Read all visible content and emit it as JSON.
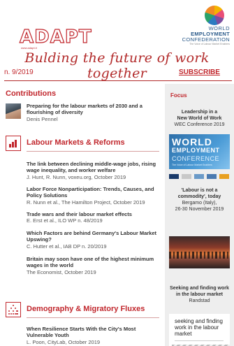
{
  "header": {
    "logo_text": "ADAPT",
    "logo_url": "www.adapt.it",
    "wec": {
      "line1": "WORLD",
      "line2": "EMPLOYMENT",
      "line3": "CONFEDERATION",
      "line4": "The Voice of Labour Market Enablers"
    },
    "tagline": "Bulding the future of work together"
  },
  "issue": "n. 9/2019",
  "subscribe_label": "SUBSCRIBE",
  "contributions": {
    "heading": "Contributions",
    "item": {
      "title": "Preparing for the labour markets of 2030 and a flourishing of diversity",
      "author": "Denis Pennel"
    }
  },
  "labour": {
    "heading": "Labour Markets & Reforms",
    "articles": [
      {
        "title": "The link between declining middle-wage jobs, rising wage inequality, and worker welfare",
        "meta": "J. Hunt, R. Nunn, voxeu.org, October 2019"
      },
      {
        "title": "Labor Force Nonparticipation: Trends, Causes, and Policy Solutions",
        "meta": "R. Nunn et al., The Hamilton Project, October 2019"
      },
      {
        "title": "Trade wars and their labour market effects",
        "meta": "E. Erst et al., ILO WP n. 48/2019"
      },
      {
        "title": "Which Factors are behind Germany's Labour Market Upswing?",
        "meta": "C. Hutter et al., IAB DP n. 20/2019"
      },
      {
        "title": "Britain may soon have one of the highest minimum wages in the world",
        "meta": "The Economist, October 2019"
      }
    ]
  },
  "demography": {
    "heading": "Demography & Migratory Fluxes",
    "articles": [
      {
        "title": "When Resilience Starts With the City's Most Vulnerable Youth",
        "meta": "L. Poon, CityLab, October 2019"
      }
    ]
  },
  "sidebar": {
    "heading": "Focus",
    "focus1": {
      "l1": "Leadership in a",
      "l2": "New World of Work",
      "l3": "WEC Conference 2019"
    },
    "banner": {
      "w": "WORLD",
      "e": "EMPLOYMENT",
      "c": "CONFERENCE",
      "s": "The Voice of Labour Market Enablers"
    },
    "focus2": {
      "l1": "'Labour is not a",
      "l2": "commodity', today",
      "l3": "Bergamo (Italy),",
      "l4": "26-30 November 2019"
    },
    "focus3": {
      "l1": "Seeking and finding work",
      "l2": "in the labour market",
      "l3": "Randstad"
    },
    "doc_title": "seeking and finding work in the labour market"
  },
  "colors": {
    "brand_red": "#c1272d",
    "sidebar_bg": "#eeeeee"
  }
}
